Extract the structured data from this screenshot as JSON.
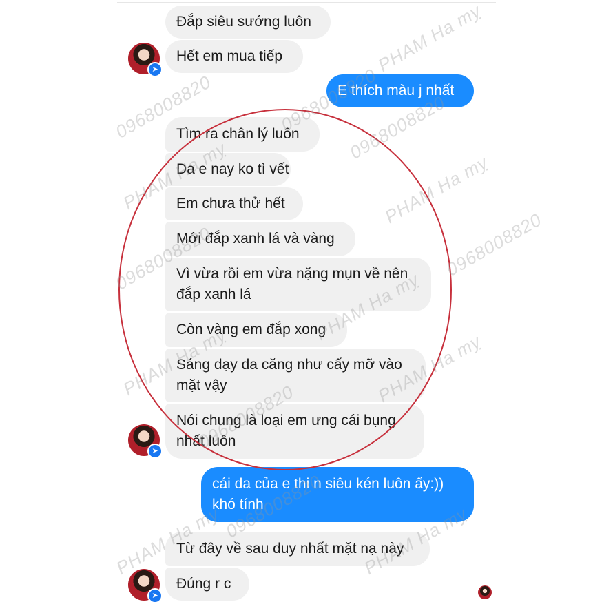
{
  "messages": [
    {
      "from": "them",
      "text": "Đắp siêu sướng luôn"
    },
    {
      "from": "them",
      "text": "Hết em mua tiếp"
    },
    {
      "from": "me",
      "text": "E thích màu j nhất"
    },
    {
      "from": "them",
      "text": "Tìm ra chân lý luôn"
    },
    {
      "from": "them",
      "text": "Da e nay ko tì vết"
    },
    {
      "from": "them",
      "text": "Em chưa thử hết"
    },
    {
      "from": "them",
      "text": "Mới đắp xanh lá và vàng"
    },
    {
      "from": "them",
      "line1": "Vì vừa rồi em vừa nặng mụn về nên",
      "line2": "đắp xanh lá"
    },
    {
      "from": "them",
      "text": "Còn vàng em đắp xong"
    },
    {
      "from": "them",
      "line1": "Sáng dạy da căng như cấy mỡ vào",
      "line2": "mặt vậy"
    },
    {
      "from": "them",
      "line1": "Nói chung là loại em ưng cái bụng",
      "line2": "nhất luôn"
    },
    {
      "from": "me",
      "line1": "cái da của e thi n siêu kén luôn ấy:))",
      "line2": "khó tính"
    },
    {
      "from": "them",
      "text": "Từ đây về sau duy nhất mặt nạ này"
    },
    {
      "from": "them",
      "text": "Đúng r c"
    }
  ],
  "watermarks": {
    "name": "PHAM Ha mỵ",
    "phone": "0968008820"
  },
  "colors": {
    "incoming_bubble": "#f0f0f0",
    "outgoing_bubble": "#1a8cff",
    "annotation_circle": "#c7303c"
  },
  "icons": {
    "avatar": "contact-avatar",
    "badge": "messenger-badge-icon",
    "seen": "seen-avatar-icon"
  }
}
